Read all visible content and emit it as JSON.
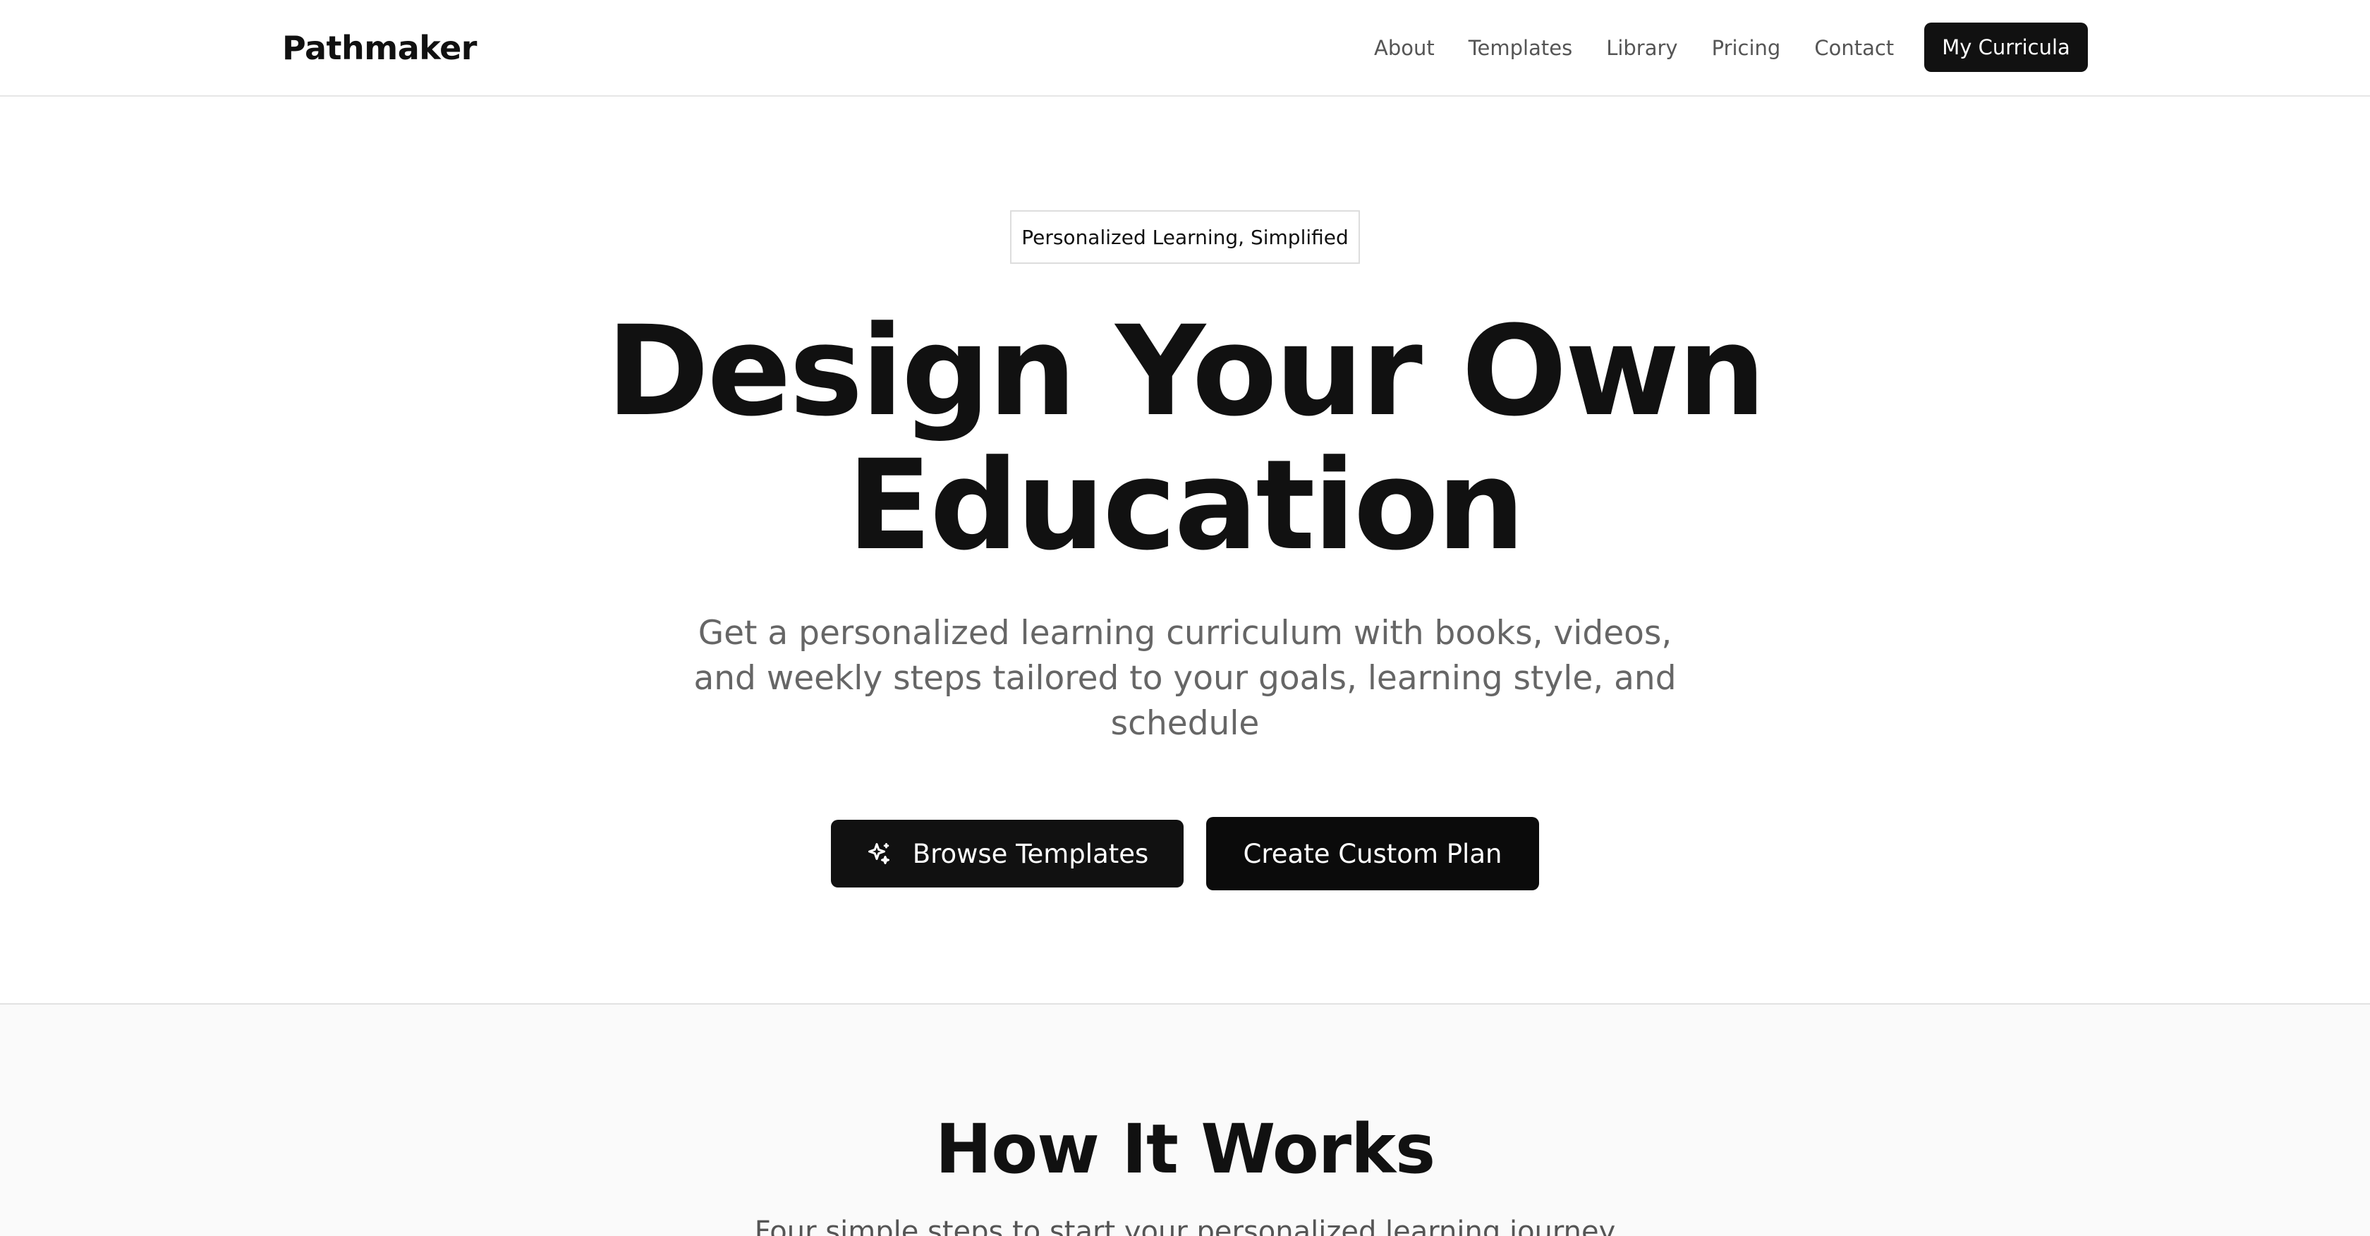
{
  "header": {
    "logo": "Pathmaker",
    "nav": [
      "About",
      "Templates",
      "Library",
      "Pricing",
      "Contact"
    ],
    "cta_label": "My Curricula"
  },
  "hero": {
    "badge": "Personalized Learning, Simplified",
    "title_line1": "Design Your Own",
    "title_line2": "Education",
    "subtitle": "Get a personalized learning curriculum with books, videos, and weekly steps tailored to your goals, learning style, and schedule",
    "browse_label": "Browse Templates",
    "browse_icon": "sparkle-icon",
    "custom_label": "Create Custom Plan"
  },
  "how_it_works": {
    "title": "How It Works",
    "subtitle": "Four simple steps to start your personalized learning journey"
  },
  "colors": {
    "primary": "#111111",
    "text_muted": "#666666",
    "border": "#e6e6e6",
    "section_bg": "#fafafa"
  }
}
